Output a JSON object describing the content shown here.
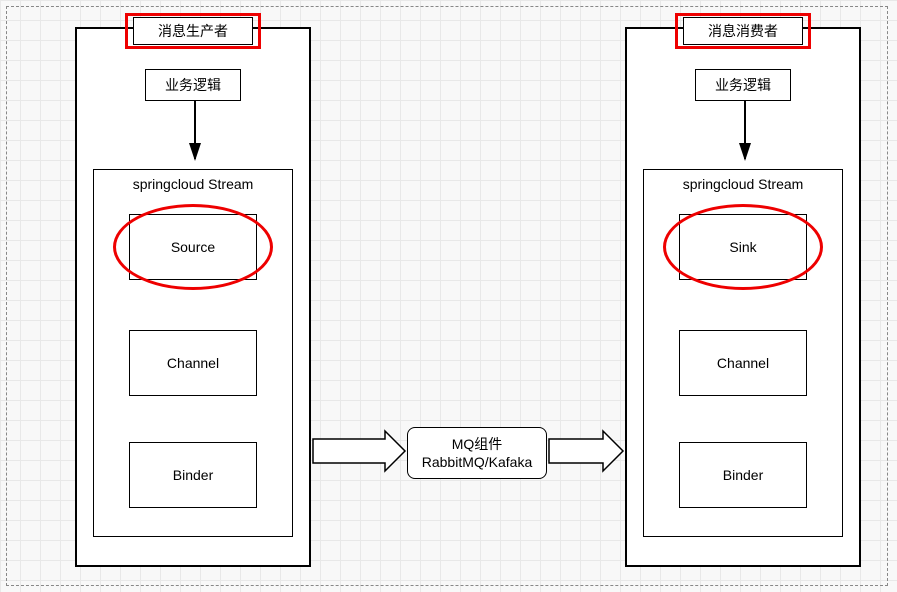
{
  "producer": {
    "title": "消息生产者",
    "logic": "业务逻辑",
    "stream_title": "springcloud Stream",
    "source": "Source",
    "channel": "Channel",
    "binder": "Binder"
  },
  "consumer": {
    "title": "消息消费者",
    "logic": "业务逻辑",
    "stream_title": "springcloud Stream",
    "sink": "Sink",
    "channel": "Channel",
    "binder": "Binder"
  },
  "mq": {
    "line1": "MQ组件",
    "line2": "RabbitMQ/Kafaka"
  }
}
